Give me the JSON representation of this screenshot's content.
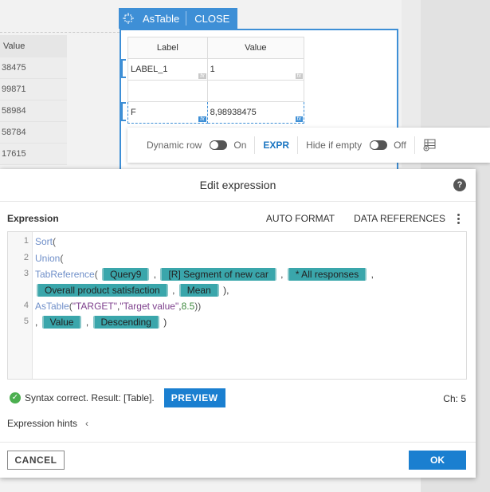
{
  "background_table": {
    "header": "Value",
    "rows": [
      "38475",
      "99871",
      "58984",
      "58784",
      "17615"
    ]
  },
  "widget": {
    "title": "AsTable",
    "close_label": "CLOSE",
    "columns": [
      "Label",
      "Value"
    ],
    "rows": [
      {
        "label": "LABEL_1",
        "value": "1"
      },
      {
        "label": "",
        "value": ""
      },
      {
        "label": "F",
        "value": "8,98938475"
      }
    ],
    "fx": "fx"
  },
  "toolbar": {
    "dynamic_row_label": "Dynamic row",
    "dynamic_row_state": "On",
    "expr_label": "EXPR",
    "hide_if_empty_label": "Hide if empty",
    "hide_if_empty_state": "Off"
  },
  "dialog": {
    "title": "Edit expression",
    "help": "?",
    "expression_label": "Expression",
    "auto_format": "AUTO FORMAT",
    "data_references": "DATA REFERENCES",
    "line_numbers": [
      "1",
      "2",
      "3",
      "4",
      "5"
    ],
    "code": {
      "l1_fn": "Sort",
      "l2_fn": "Union",
      "l3_fn": "TabReference",
      "tok_query": "Query9",
      "tok_segment": "[R] Segment of new car",
      "tok_responses": "* All responses",
      "tok_overall": "Overall product satisfaction",
      "tok_mean": "Mean",
      "l4_fn": "AsTable",
      "l4_str1": "\"TARGET\"",
      "l4_str2": "\"Target value\"",
      "l4_num": "8.5",
      "tok_value": "Value",
      "tok_desc": "Descending"
    },
    "status_text": "Syntax correct. Result: [Table].",
    "preview_label": "PREVIEW",
    "ch_label": "Ch:",
    "ch_value": "5",
    "hints_label": "Expression hints",
    "cancel_label": "CANCEL",
    "ok_label": "OK"
  }
}
